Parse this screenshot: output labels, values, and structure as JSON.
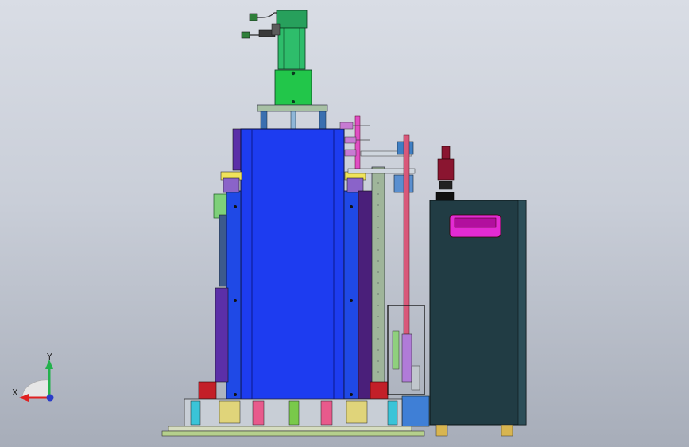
{
  "viewport": {
    "background_top": "#d9dde5",
    "background_bottom": "#a7adb9"
  },
  "triad": {
    "y_label": "Y",
    "x_label": "X",
    "y_color": "#22b14c",
    "x_color": "#e02020",
    "z_color": "#2a3cc8"
  },
  "colors": {
    "motor": "#2ebd6b",
    "coupling": "#22c64a",
    "column": "#1d3cf0",
    "column_dark": "#0e1f9e",
    "purple_rail": "#5b2fa8",
    "cabinet": "#213c44",
    "cabinet_handle": "#e32bd3",
    "plug": "#8a1530",
    "pink_rod": "#d8587a",
    "frame_sage": "#9fb59a"
  }
}
